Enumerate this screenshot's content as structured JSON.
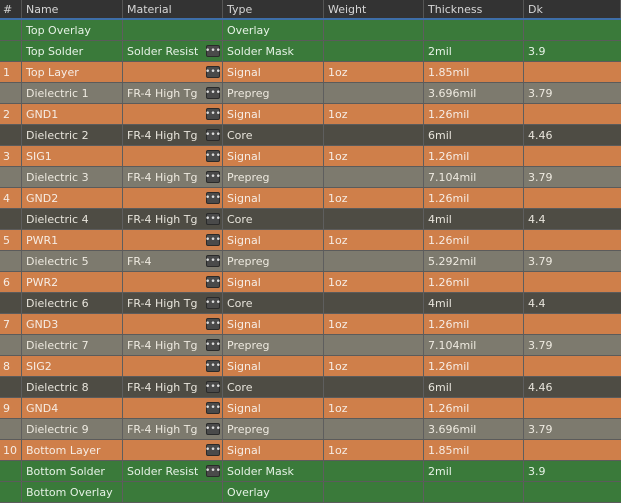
{
  "columns": [
    "#",
    "Name",
    "Material",
    "Type",
    "Weight",
    "Thickness",
    "Dk"
  ],
  "dots_glyph": "•••",
  "rows": [
    {
      "num": "",
      "name": "Top Overlay",
      "material": "",
      "dots": false,
      "type": "Overlay",
      "weight": "",
      "thickness": "",
      "dk": "",
      "kind": "overlay"
    },
    {
      "num": "",
      "name": "Top Solder",
      "material": "Solder Resist",
      "dots": true,
      "type": "Solder Mask",
      "weight": "",
      "thickness": "2mil",
      "dk": "3.9",
      "kind": "mask"
    },
    {
      "num": "1",
      "name": "Top Layer",
      "material": "",
      "dots": true,
      "type": "Signal",
      "weight": "1oz",
      "thickness": "1.85mil",
      "dk": "",
      "kind": "signal"
    },
    {
      "num": "",
      "name": "Dielectric 1",
      "material": "FR-4 High Tg",
      "dots": true,
      "type": "Prepreg",
      "weight": "",
      "thickness": "3.696mil",
      "dk": "3.79",
      "kind": "prepreg"
    },
    {
      "num": "2",
      "name": "GND1",
      "material": "",
      "dots": true,
      "type": "Signal",
      "weight": "1oz",
      "thickness": "1.26mil",
      "dk": "",
      "kind": "signal"
    },
    {
      "num": "",
      "name": "Dielectric 2",
      "material": "FR-4 High Tg",
      "dots": true,
      "type": "Core",
      "weight": "",
      "thickness": "6mil",
      "dk": "4.46",
      "kind": "core"
    },
    {
      "num": "3",
      "name": "SIG1",
      "material": "",
      "dots": true,
      "type": "Signal",
      "weight": "1oz",
      "thickness": "1.26mil",
      "dk": "",
      "kind": "signal"
    },
    {
      "num": "",
      "name": "Dielectric 3",
      "material": "FR-4 High Tg",
      "dots": true,
      "type": "Prepreg",
      "weight": "",
      "thickness": "7.104mil",
      "dk": "3.79",
      "kind": "prepreg"
    },
    {
      "num": "4",
      "name": "GND2",
      "material": "",
      "dots": true,
      "type": "Signal",
      "weight": "1oz",
      "thickness": "1.26mil",
      "dk": "",
      "kind": "signal"
    },
    {
      "num": "",
      "name": "Dielectric 4",
      "material": "FR-4 High Tg",
      "dots": true,
      "type": "Core",
      "weight": "",
      "thickness": "4mil",
      "dk": "4.4",
      "kind": "core"
    },
    {
      "num": "5",
      "name": "PWR1",
      "material": "",
      "dots": true,
      "type": "Signal",
      "weight": "1oz",
      "thickness": "1.26mil",
      "dk": "",
      "kind": "signal"
    },
    {
      "num": "",
      "name": "Dielectric 5",
      "material": "FR-4",
      "dots": true,
      "type": "Prepreg",
      "weight": "",
      "thickness": "5.292mil",
      "dk": "3.79",
      "kind": "prepreg"
    },
    {
      "num": "6",
      "name": "PWR2",
      "material": "",
      "dots": true,
      "type": "Signal",
      "weight": "1oz",
      "thickness": "1.26mil",
      "dk": "",
      "kind": "signal"
    },
    {
      "num": "",
      "name": "Dielectric 6",
      "material": "FR-4 High Tg",
      "dots": true,
      "type": "Core",
      "weight": "",
      "thickness": "4mil",
      "dk": "4.4",
      "kind": "core"
    },
    {
      "num": "7",
      "name": "GND3",
      "material": "",
      "dots": true,
      "type": "Signal",
      "weight": "1oz",
      "thickness": "1.26mil",
      "dk": "",
      "kind": "signal"
    },
    {
      "num": "",
      "name": "Dielectric 7",
      "material": "FR-4 High Tg",
      "dots": true,
      "type": "Prepreg",
      "weight": "",
      "thickness": "7.104mil",
      "dk": "3.79",
      "kind": "prepreg"
    },
    {
      "num": "8",
      "name": "SIG2",
      "material": "",
      "dots": true,
      "type": "Signal",
      "weight": "1oz",
      "thickness": "1.26mil",
      "dk": "",
      "kind": "signal"
    },
    {
      "num": "",
      "name": "Dielectric 8",
      "material": "FR-4 High Tg",
      "dots": true,
      "type": "Core",
      "weight": "",
      "thickness": "6mil",
      "dk": "4.46",
      "kind": "core"
    },
    {
      "num": "9",
      "name": "GND4",
      "material": "",
      "dots": true,
      "type": "Signal",
      "weight": "1oz",
      "thickness": "1.26mil",
      "dk": "",
      "kind": "signal"
    },
    {
      "num": "",
      "name": "Dielectric 9",
      "material": "FR-4 High Tg",
      "dots": true,
      "type": "Prepreg",
      "weight": "",
      "thickness": "3.696mil",
      "dk": "3.79",
      "kind": "prepreg"
    },
    {
      "num": "10",
      "name": "Bottom Layer",
      "material": "",
      "dots": true,
      "type": "Signal",
      "weight": "1oz",
      "thickness": "1.85mil",
      "dk": "",
      "kind": "signal"
    },
    {
      "num": "",
      "name": "Bottom Solder",
      "material": "Solder Resist",
      "dots": true,
      "type": "Solder Mask",
      "weight": "",
      "thickness": "2mil",
      "dk": "3.9",
      "kind": "mask"
    },
    {
      "num": "",
      "name": "Bottom Overlay",
      "material": "",
      "dots": false,
      "type": "Overlay",
      "weight": "",
      "thickness": "",
      "dk": "",
      "kind": "overlay"
    }
  ],
  "colors": {
    "overlay": "#3a7a3a",
    "mask": "#3a7a3a",
    "signal": "#cf7f4a",
    "prepreg": "#7d7a6e",
    "core": "#4e4c44",
    "header": "#333333",
    "header_underline": "#3e6ea8"
  }
}
